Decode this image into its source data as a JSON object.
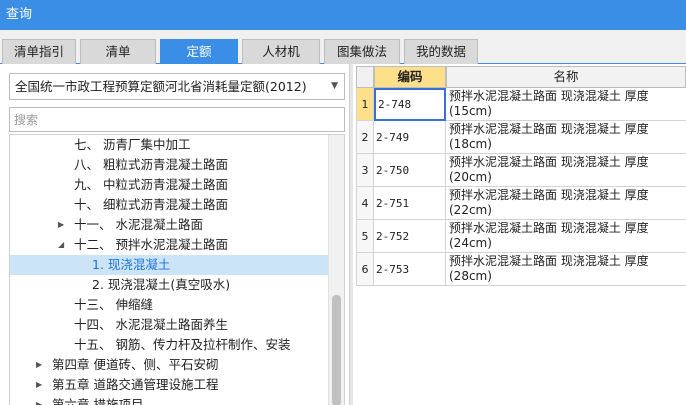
{
  "window": {
    "title": "查询"
  },
  "tabs": [
    {
      "label": "清单指引"
    },
    {
      "label": "清单"
    },
    {
      "label": "定额",
      "active": true
    },
    {
      "label": "人材机"
    },
    {
      "label": "图集做法"
    },
    {
      "label": "我的数据"
    }
  ],
  "left_panel": {
    "library_select": "全国统一市政工程预算定额河北省消耗量定额(2012)",
    "search_placeholder": "搜索",
    "tree": [
      {
        "label": "七、 沥青厂集中加工"
      },
      {
        "label": "八、 粗粒式沥青混凝土路面"
      },
      {
        "label": "九、 中粒式沥青混凝土路面"
      },
      {
        "label": "十、 细粒式沥青混凝土路面"
      },
      {
        "label": "十一、 水泥混凝土路面",
        "toggle": "collapsed"
      },
      {
        "label": "十二、 预拌水泥混凝土路面",
        "toggle": "expanded"
      },
      {
        "label": "1. 现浇混凝土",
        "selected": true
      },
      {
        "label": "2. 现浇混凝土(真空吸水)"
      },
      {
        "label": "十三、 伸缩缝"
      },
      {
        "label": "十四、 水泥混凝土路面养生"
      },
      {
        "label": "十五、 钢筋、传力杆及拉杆制作、安装"
      },
      {
        "label": "第四章 便道砖、侧、平石安砌",
        "toggle": "collapsed"
      },
      {
        "label": "第五章 道路交通管理设施工程",
        "toggle": "collapsed"
      },
      {
        "label": "第六章 措施项目",
        "toggle": "collapsed"
      }
    ]
  },
  "table": {
    "headers": {
      "code": "编码",
      "name": "名称"
    },
    "rows": [
      {
        "num": "1",
        "code": "2-748",
        "name": "预拌水泥混凝土路面 现浇混凝土 厚度(15cm)"
      },
      {
        "num": "2",
        "code": "2-749",
        "name": "预拌水泥混凝土路面 现浇混凝土 厚度(18cm)"
      },
      {
        "num": "3",
        "code": "2-750",
        "name": "预拌水泥混凝土路面 现浇混凝土 厚度(20cm)"
      },
      {
        "num": "4",
        "code": "2-751",
        "name": "预拌水泥混凝土路面 现浇混凝土 厚度(22cm)"
      },
      {
        "num": "5",
        "code": "2-752",
        "name": "预拌水泥混凝土路面 现浇混凝土 厚度(24cm)"
      },
      {
        "num": "6",
        "code": "2-753",
        "name": "预拌水泥混凝土路面 现浇混凝土 厚度(28cm)"
      }
    ]
  },
  "colors": {
    "title_bar": "#3a8ee6",
    "selected_row": "#cce4f7",
    "header_highlight": "#ffe08a"
  }
}
